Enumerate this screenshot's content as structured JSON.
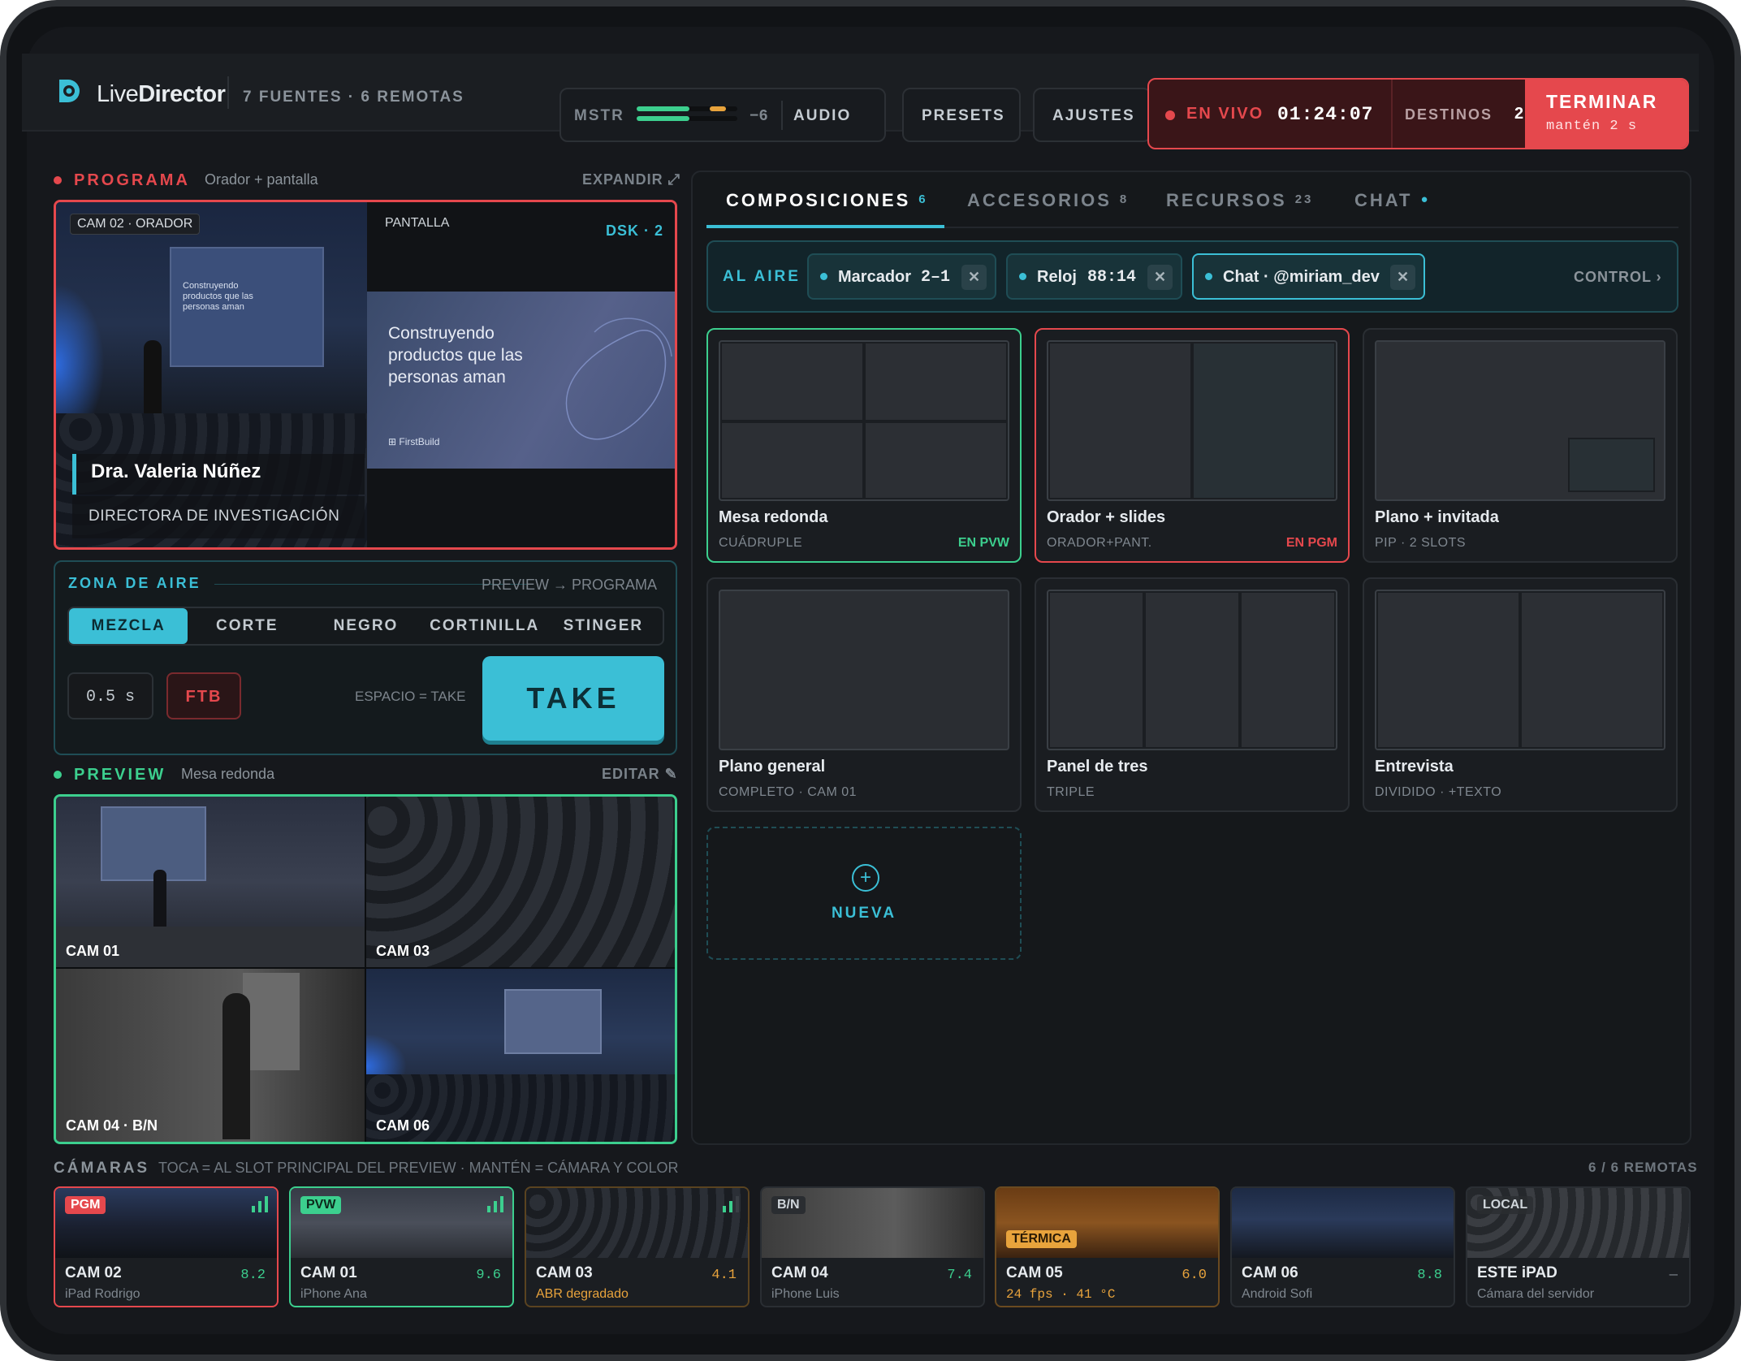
{
  "app": {
    "name_light": "Live",
    "name_bold": "Director",
    "sources": "7 FUENTES · 6 REMOTAS"
  },
  "topbar": {
    "mstr_label": "MSTR",
    "mstr_db": "−6",
    "mstr_level": 0.75,
    "audio_label": "AUDIO",
    "presets_label": "PRESETS",
    "settings_label": "AJUSTES",
    "live_label": "EN VIVO",
    "timer": "01:24:07",
    "destinations_label": "DESTINOS",
    "destinations_count": "2",
    "end_label": "TERMINAR",
    "end_hint": "mantén 2 s"
  },
  "program": {
    "title": "PROGRAMA",
    "subtitle": "Orador + pantalla",
    "expand": "EXPANDIR ⤢",
    "cam_tag": "CAM 02 · ORADOR",
    "screen_tag": "PANTALLA",
    "dsk": "DSK · 2",
    "lower_third_name": "Dra. Valeria Núñez",
    "lower_third_role": "DIRECTORA DE INVESTIGACIÓN",
    "slide_text": "Construyendo productos que las personas aman",
    "slide_brand": "FirstBuild"
  },
  "air": {
    "title": "ZONA DE AIRE",
    "hint": "PREVIEW → PROGRAMA",
    "transitions": [
      "MEZCLA",
      "CORTE",
      "NEGRO",
      "CORTINILLA",
      "STINGER"
    ],
    "active_transition": "MEZCLA",
    "duration": "0.5 s",
    "ftb": "FTB",
    "take_hint": "ESPACIO = TAKE",
    "take": "TAKE"
  },
  "preview": {
    "title": "PREVIEW",
    "subtitle": "Mesa redonda",
    "edit": "EDITAR ✎",
    "tiles": [
      "CAM 01",
      "CAM 03",
      "CAM 04 · B/N",
      "CAM 06"
    ]
  },
  "tabs": [
    {
      "label": "COMPOSICIONES",
      "count": "6",
      "active": true
    },
    {
      "label": "ACCESORIOS",
      "count": "8"
    },
    {
      "label": "RECURSOS",
      "count": "23"
    },
    {
      "label": "CHAT",
      "count": "●"
    }
  ],
  "onair": {
    "label": "AL AIRE",
    "control": "CONTROL ›",
    "chips": [
      {
        "label": "Marcador",
        "value": "2–1"
      },
      {
        "label": "Reloj",
        "value": "88:14"
      },
      {
        "label": "Chat · @miriam_dev",
        "value": ""
      }
    ]
  },
  "compositions": [
    {
      "name": "Mesa redonda",
      "type": "CUÁDRUPLE",
      "status": "EN PVW",
      "status_color": "#3ccf8e"
    },
    {
      "name": "Orador + slides",
      "type": "ORADOR+PANT.",
      "status": "EN PGM",
      "status_color": "#e5484d"
    },
    {
      "name": "Plano + invitada",
      "type": "PIP · 2 SLOTS",
      "status": ""
    },
    {
      "name": "Plano general",
      "type": "COMPLETO · CAM 01",
      "status": ""
    },
    {
      "name": "Panel de tres",
      "type": "TRIPLE",
      "status": ""
    },
    {
      "name": "Entrevista",
      "type": "DIVIDIDO · +TEXTO",
      "status": ""
    }
  ],
  "new_comp": {
    "icon": "plus-circle-icon",
    "label": "NUEVA"
  },
  "cameras": {
    "title": "CÁMARAS",
    "hint": "TOCA = AL SLOT PRINCIPAL DEL PREVIEW · MANTÉN = CÁMARA Y COLOR",
    "remote_count": "6 / 6 REMOTAS",
    "items": [
      {
        "badge": "PGM",
        "name": "CAM 02",
        "device": "iPad Rodrigo",
        "score": "8.2"
      },
      {
        "badge": "PVW",
        "name": "CAM 01",
        "device": "iPhone Ana",
        "score": "9.6"
      },
      {
        "badge": "",
        "name": "CAM 03",
        "device": "ABR degradado",
        "score": "4.1"
      },
      {
        "badge": "B/N",
        "name": "CAM 04",
        "device": "iPhone Luis",
        "score": "7.4"
      },
      {
        "badge": "TÉRMICA",
        "name": "CAM 05",
        "device": "24 fps · 41 °C",
        "score": "6.0"
      },
      {
        "badge": "",
        "name": "CAM 06",
        "device": "Android Sofi",
        "score": "8.8"
      },
      {
        "badge": "LOCAL",
        "name": "ESTE iPAD",
        "device": "Cámara del servidor",
        "score": "—"
      }
    ]
  },
  "colors": {
    "accent": "#3bbfd6",
    "program": "#e5484d",
    "preview": "#3ccf8e",
    "warning": "#e8a33c"
  }
}
